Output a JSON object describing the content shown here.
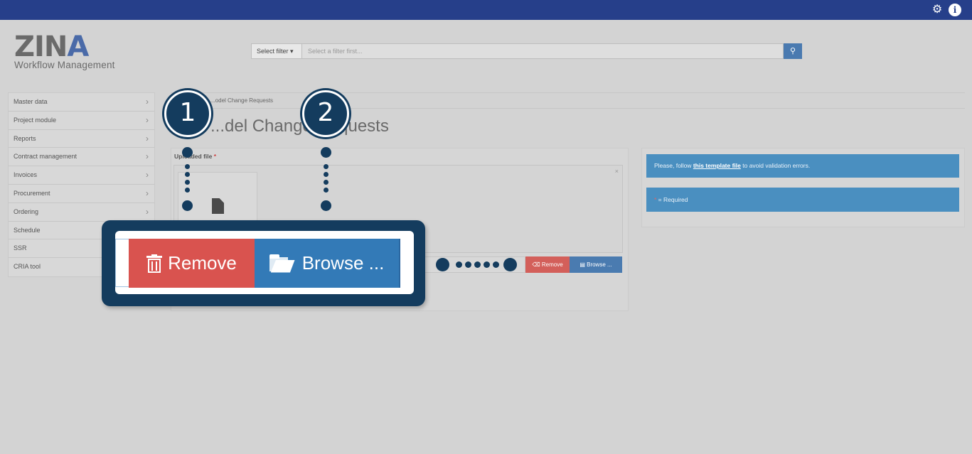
{
  "topbar": {
    "settings_icon": "gear-icon",
    "info_icon": "info-icon",
    "info_glyph": "i"
  },
  "logo": {
    "name_main": "ZIN",
    "name_accent": "A",
    "subtitle": "Workflow Management"
  },
  "filter": {
    "button_label": "Select filter ▾",
    "placeholder": "Select a filter first...",
    "search_icon": "search-icon"
  },
  "sidebar": {
    "items": [
      {
        "label": "Master data"
      },
      {
        "label": "Project module"
      },
      {
        "label": "Reports"
      },
      {
        "label": "Contract management"
      },
      {
        "label": "Invoices"
      },
      {
        "label": "Procurement"
      },
      {
        "label": "Ordering"
      },
      {
        "label": "Schedule"
      },
      {
        "label": "SSR"
      },
      {
        "label": "CRIA tool"
      }
    ]
  },
  "breadcrumb": "...odel Change Requests",
  "page_title": "...del Change Requests",
  "form": {
    "uploaded_label": "Uploaded file",
    "required_mark": "*",
    "close_glyph": "×",
    "remove_label": "Remove",
    "browse_label": "Browse ..."
  },
  "alerts": {
    "template_prefix": "Please, follow ",
    "template_link": "this template file",
    "template_suffix": " to avoid validation errors.",
    "required_star": "*",
    "required_text": " = Required"
  },
  "callout": {
    "remove_label": "Remove",
    "browse_label": "Browse ..."
  },
  "markers": {
    "first": "1",
    "second": "2"
  },
  "colors": {
    "topbar": "#263f8a",
    "remove": "#d9534f",
    "browse": "#337ab7",
    "callout": "#143c5e",
    "alert": "#4a8fc0"
  }
}
